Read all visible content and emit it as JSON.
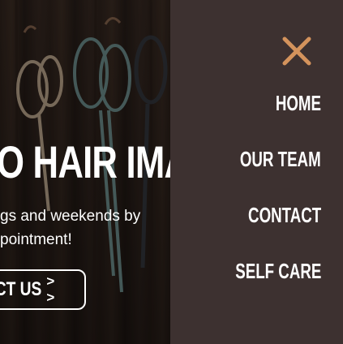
{
  "hero": {
    "heading": "O HAIR IMA",
    "subtext_line1": "gs and weekends by",
    "subtext_line2": "pointment!",
    "cta_label": "ACT US",
    "cta_arrows": "> >"
  },
  "menu": {
    "close_icon": "close-icon",
    "items": [
      {
        "label": "HOME"
      },
      {
        "label": "OUR TEAM"
      },
      {
        "label": "CONTACT"
      },
      {
        "label": "SELF CARE"
      }
    ]
  },
  "colors": {
    "menu_background": "#3d3130",
    "close_icon": "#d4935c",
    "text": "#ffffff"
  }
}
